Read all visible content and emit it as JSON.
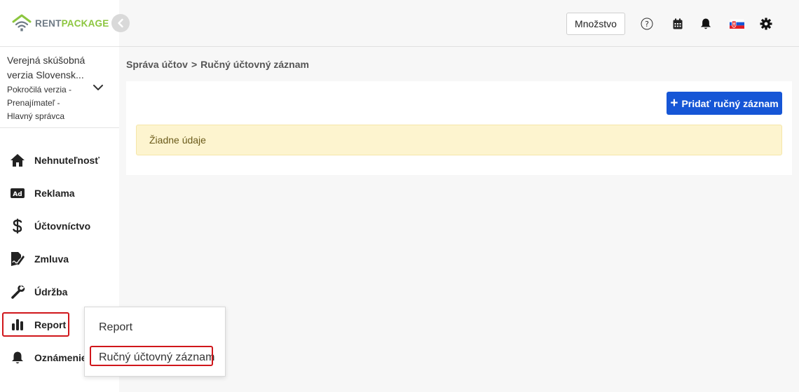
{
  "brand": {
    "rent": "RENT",
    "package": "PACKAGE"
  },
  "account": {
    "name_line1": "Verejná skúšobná",
    "name_line2": "verzia Slovensk...",
    "meta_line1": "Pokročilá verzia -",
    "meta_line2": "Prenajímateľ -",
    "meta_line3": "Hlavný správca"
  },
  "sidebar": {
    "items": [
      {
        "label": "Nehnuteľnosť",
        "icon": "home-icon"
      },
      {
        "label": "Reklama",
        "icon": "ad-icon"
      },
      {
        "label": "Účtovníctvo",
        "icon": "dollar-icon"
      },
      {
        "label": "Zmluva",
        "icon": "contract-icon"
      },
      {
        "label": "Údržba",
        "icon": "wrench-icon"
      },
      {
        "label": "Report",
        "icon": "bar-chart-icon"
      },
      {
        "label": "Oznámenie",
        "icon": "bell-icon"
      }
    ]
  },
  "topbar": {
    "quantity_label": "Množstvo",
    "icons": [
      "help-icon",
      "calendar-icon",
      "notification-bell-icon",
      "slovak-flag-icon",
      "settings-gear-icon"
    ]
  },
  "breadcrumb": {
    "parent": "Správa účtov",
    "separator": ">",
    "current": "Ručný účtovný záznam"
  },
  "main": {
    "add_button_label": "Pridať ručný záznam",
    "empty_message": "Žiadne údaje"
  },
  "report_menu": {
    "items": [
      "Report",
      "Ručný účtovný záznam"
    ]
  },
  "colors": {
    "primary": "#1656d6",
    "brand_green": "#8cc63f",
    "brand_gray": "#6f7b86",
    "highlight_red": "#d0161b",
    "alert_bg": "#fdf4cf"
  }
}
